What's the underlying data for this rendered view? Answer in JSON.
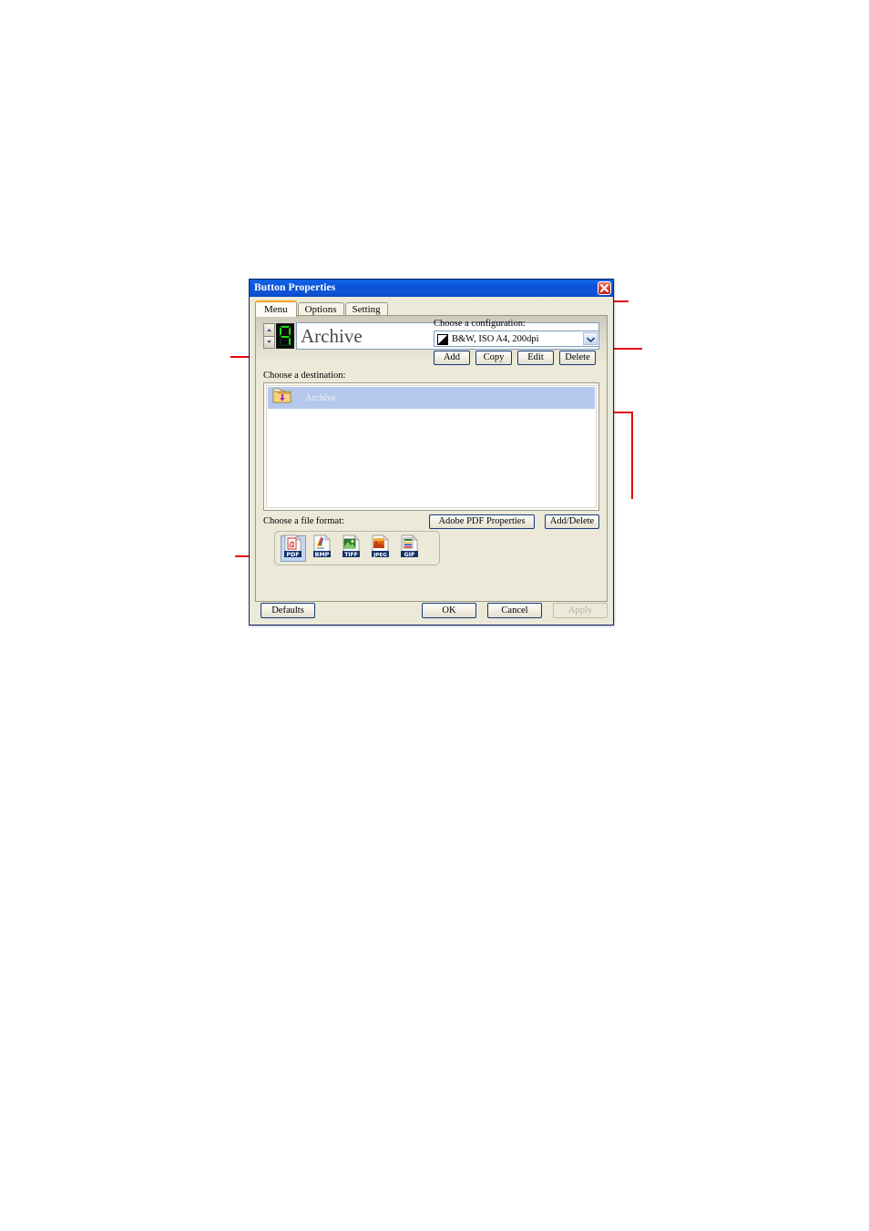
{
  "dialog": {
    "title": "Button Properties",
    "close_icon": "close-icon"
  },
  "tabs": [
    {
      "label": "Menu",
      "active": true
    },
    {
      "label": "Options",
      "active": false
    },
    {
      "label": "Setting",
      "active": false
    }
  ],
  "menu_tab": {
    "button_number": "9",
    "button_name": "Archive",
    "spinner_up_icon": "chevron-up-icon",
    "spinner_down_icon": "chevron-down-icon",
    "configuration": {
      "label": "Choose a configuration:",
      "selected": "B&W, ISO A4, 200dpi",
      "dropdown_icon": "chevron-down-icon",
      "buttons": [
        {
          "label": "Add"
        },
        {
          "label": "Copy"
        },
        {
          "label": "Edit"
        },
        {
          "label": "Delete"
        }
      ]
    },
    "destination": {
      "label": "Choose a destination:",
      "items": [
        {
          "label": "Archive",
          "icon": "folder-download-icon",
          "selected": true
        }
      ]
    },
    "file_format": {
      "label": "Choose a file format:",
      "selected": "PDF",
      "options": [
        {
          "label": "PDF",
          "icon": "pdf-file-icon"
        },
        {
          "label": "BMP",
          "icon": "bmp-file-icon"
        },
        {
          "label": "TIFF",
          "icon": "tiff-file-icon"
        },
        {
          "label": "JPEG",
          "icon": "jpeg-file-icon"
        },
        {
          "label": "GIF",
          "icon": "gif-file-icon"
        }
      ],
      "side_buttons": [
        {
          "label": "Adobe PDF Properties"
        },
        {
          "label": "Add/Delete"
        }
      ]
    }
  },
  "footer": {
    "defaults_label": "Defaults",
    "ok_label": "OK",
    "cancel_label": "Cancel",
    "apply_label": "Apply",
    "apply_enabled": false
  },
  "annotations": {
    "color": "#e8000d",
    "callouts": [
      {
        "name": "callout-tabs"
      },
      {
        "name": "callout-configuration"
      },
      {
        "name": "callout-button-number"
      },
      {
        "name": "callout-destination"
      },
      {
        "name": "callout-file-format"
      }
    ]
  }
}
